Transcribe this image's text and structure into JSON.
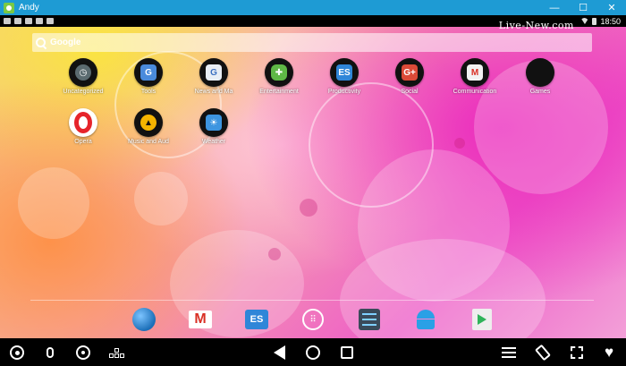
{
  "window": {
    "title": "Andy",
    "controls": {
      "minimize": "—",
      "maximize": "☐",
      "close": "✕"
    }
  },
  "status_bar": {
    "time": "18:50"
  },
  "watermark": "Live-New.com",
  "search": {
    "label": "Google"
  },
  "apps": [
    {
      "label": "Uncategorized",
      "icon": "clock-icon",
      "color": "#5b6b70"
    },
    {
      "label": "Tools",
      "icon": "google-tools-icon",
      "color": "#4a8bdc"
    },
    {
      "label": "News and Ma",
      "icon": "news-icon",
      "color": "#e8eef5"
    },
    {
      "label": "Entertainment",
      "icon": "game-controller-icon",
      "color": "#5fb846"
    },
    {
      "label": "Productivity",
      "icon": "es-folder-icon",
      "color": "#2f86d8"
    },
    {
      "label": "Social",
      "icon": "google-plus-icon",
      "color": "#dc4a38"
    },
    {
      "label": "Communication",
      "icon": "gmail-icon",
      "color": "#f2f2f2"
    },
    {
      "label": "Games",
      "icon": "games-icon",
      "color": "#111111"
    },
    {
      "label": "Opera",
      "icon": "opera-icon",
      "color": "#e6242b"
    },
    {
      "label": "Music and Aud",
      "icon": "music-player-icon",
      "color": "#f5b400"
    },
    {
      "label": "Weather",
      "icon": "weather-icon",
      "color": "#3d95e0"
    }
  ],
  "dock": [
    {
      "name": "browser-icon",
      "color": "#1c6fb8"
    },
    {
      "name": "gmail-icon",
      "color": "#d93025"
    },
    {
      "name": "es-file-explorer-icon",
      "color": "#2f86d8"
    },
    {
      "name": "app-drawer-icon",
      "color": "#ffffff"
    },
    {
      "name": "settings-icon",
      "color": "#3a4a5a"
    },
    {
      "name": "android-icon",
      "color": "#2aa0e6"
    },
    {
      "name": "play-store-icon",
      "color": "#eeeeee"
    }
  ],
  "toolbar": {
    "left": [
      "camera-icon",
      "microphone-icon",
      "gps-target-icon",
      "keymap-icon"
    ],
    "center": [
      "back-icon",
      "home-icon",
      "recents-icon"
    ],
    "right": [
      "menu-icon",
      "rotate-icon",
      "fullscreen-icon",
      "heart-icon"
    ]
  }
}
